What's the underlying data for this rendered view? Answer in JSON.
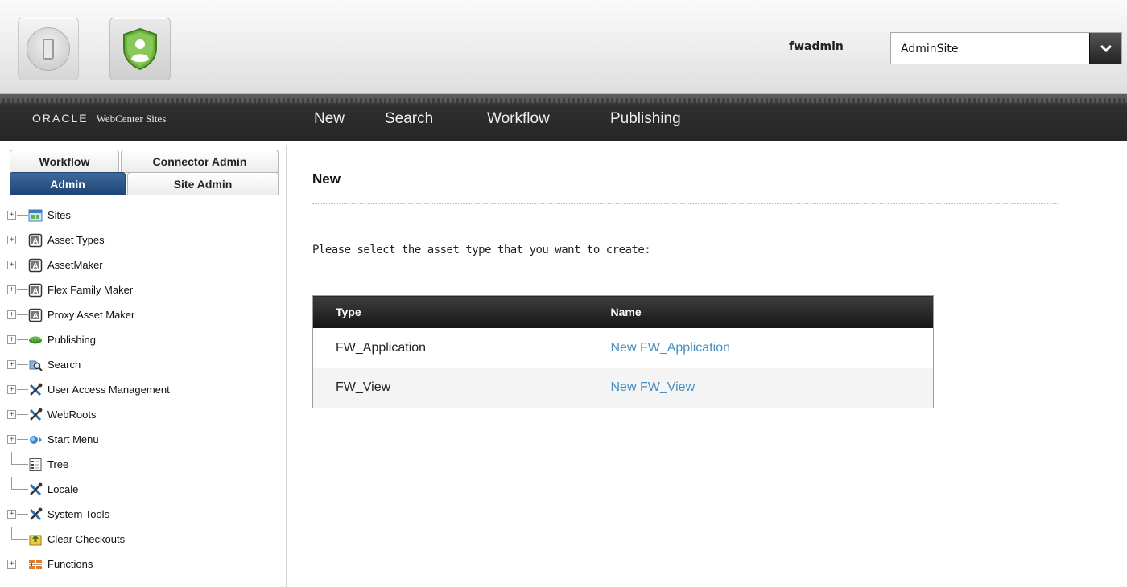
{
  "header": {
    "username": "fwadmin",
    "site_selector": {
      "selected": "AdminSite"
    },
    "app_buttons": [
      {
        "icon": "contributor-device-icon"
      },
      {
        "icon": "admin-shield-icon"
      }
    ]
  },
  "navbar": {
    "brand": {
      "oracle": "ORACLE",
      "product": "WebCenter Sites"
    },
    "items": [
      "New",
      "Search",
      "Workflow",
      "Publishing"
    ]
  },
  "left_panel": {
    "tabs_row1": [
      "Workflow",
      "Connector Admin"
    ],
    "tabs_row2": [
      "Admin",
      "Site Admin"
    ],
    "active_tab": "Admin",
    "tree": [
      {
        "label": "Sites",
        "icon": "sites-icon",
        "expandable": true
      },
      {
        "label": "Asset Types",
        "icon": "asset-a-icon",
        "expandable": true
      },
      {
        "label": "AssetMaker",
        "icon": "asset-a-icon",
        "expandable": true
      },
      {
        "label": "Flex Family Maker",
        "icon": "asset-a-icon",
        "expandable": true
      },
      {
        "label": "Proxy Asset Maker",
        "icon": "asset-a-icon",
        "expandable": true
      },
      {
        "label": "Publishing",
        "icon": "publishing-icon",
        "expandable": true
      },
      {
        "label": "Search",
        "icon": "search-icon",
        "expandable": true
      },
      {
        "label": "User Access Management",
        "icon": "tools-icon",
        "expandable": true
      },
      {
        "label": "WebRoots",
        "icon": "tools-icon",
        "expandable": true
      },
      {
        "label": "Start Menu",
        "icon": "start-menu-icon",
        "expandable": true
      },
      {
        "label": "Tree",
        "icon": "tree-icon",
        "expandable": false
      },
      {
        "label": "Locale",
        "icon": "tools-icon",
        "expandable": false
      },
      {
        "label": "System Tools",
        "icon": "tools-icon",
        "expandable": true
      },
      {
        "label": "Clear Checkouts",
        "icon": "clear-checkouts-icon",
        "expandable": false
      },
      {
        "label": "Functions",
        "icon": "functions-icon",
        "expandable": true
      }
    ]
  },
  "main": {
    "title": "New",
    "instruction": "Please select the asset type that you want to create:",
    "table": {
      "headers": [
        "Type",
        "Name"
      ],
      "rows": [
        {
          "type": "FW_Application",
          "name": "New FW_Application"
        },
        {
          "type": "FW_View",
          "name": "New FW_View"
        }
      ]
    }
  },
  "colors": {
    "nav_bg": "#262626",
    "active_tab": "#1d4573",
    "link": "#4a8fbf",
    "table_header": "#1f1f1f"
  }
}
